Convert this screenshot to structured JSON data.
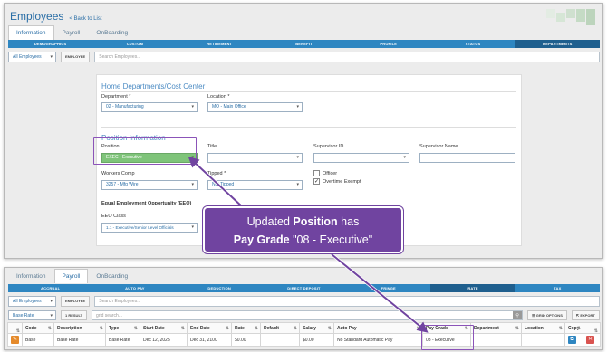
{
  "top": {
    "title": "Employees",
    "back_link": "< Back to List",
    "tabs": [
      "Information",
      "Payroll",
      "OnBoarding"
    ],
    "nav": [
      "DEMOGRAPHICS",
      "CUSTOM",
      "RETIREMENT",
      "BENEFIT",
      "PROFILE",
      "STATUS",
      "DEPARTMENTS"
    ],
    "filter_select": "All Employees",
    "employee_label": "EMPLOYEE",
    "search_placeholder": "Search Employees...",
    "section1_title": "Home Departments/Cost Center",
    "department_label": "Department *",
    "department_value": "02 - Manufacturing",
    "location_label": "Location *",
    "location_value": "MO - Main Office",
    "section2_title": "Position Information",
    "position_label": "Position",
    "position_value": "EXEC - Executive",
    "title_label": "Title",
    "supervisor_id_label": "Supervisor ID",
    "supervisor_name_label": "Supervisor Name",
    "workers_comp_label": "Workers Comp",
    "workers_comp_value": "3257 - Mfg Wire",
    "tipped_label": "Tipped *",
    "tipped_value": "Not Tipped",
    "officer_label": "Officer",
    "overtime_label": "Overtime Exempt",
    "eeo_heading": "Equal Employment Opportunity (EEO)",
    "eeo_class_label": "EEO Class",
    "eeo_class_value": "1.1 - Executive/Senior Level Officials"
  },
  "callout": {
    "line1_prefix": "Updated ",
    "line1_bold": "Position",
    "line1_suffix": " has",
    "line2_bold": "Pay Grade",
    "line2_suffix": " \"08 - Executive\""
  },
  "bottom": {
    "tabs": [
      "Information",
      "Payroll",
      "OnBoarding"
    ],
    "nav": [
      "ACCRUAL",
      "AUTO PAY",
      "DEDUCTION",
      "DIRECT DEPOSIT",
      "FRINGE",
      "RATE",
      "TAX"
    ],
    "filter_select": "All Employees",
    "employee_label": "EMPLOYEE",
    "search_placeholder": "Search Employees...",
    "rate_select": "Base Rate",
    "result_count": "1 RESULT",
    "grid_search_placeholder": "grid search...",
    "grid_options": "GRID OPTIONS",
    "export": "EXPORT",
    "columns": [
      "",
      "Code",
      "Description",
      "Type",
      "Start Date",
      "End Date",
      "Rate",
      "Default",
      "Salary",
      "Auto Pay",
      "Pay Grade",
      "Department",
      "Location",
      "Copy",
      ""
    ],
    "row": [
      "",
      "Base",
      "Base Rate",
      "Base Rate",
      "Dec 12, 2025",
      "Dec 31, 2100",
      "$0.00",
      "",
      "$0.00",
      "No Standard Automatic Pay",
      "08 - Executive",
      "",
      "",
      "",
      ""
    ]
  },
  "colors": {
    "accent": "#2e86c1",
    "callout": "#7044a0",
    "highlight": "#8b53b8",
    "position_fill": "#7fc47a"
  }
}
